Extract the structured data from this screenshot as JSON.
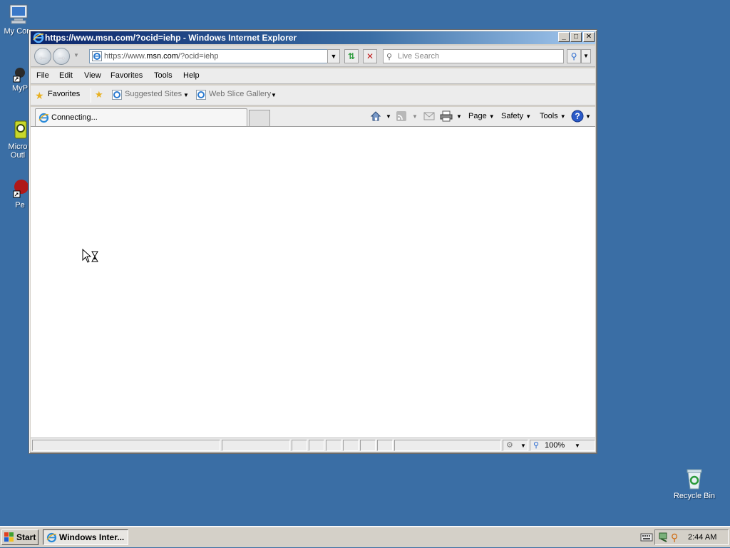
{
  "desktop": {
    "icons": [
      {
        "label": "My Com",
        "icon": "computer-icon"
      },
      {
        "label": "MyP",
        "icon": "mypc-shortcut-icon"
      },
      {
        "label": "Micro Outl",
        "icon": "outlook-icon"
      },
      {
        "label": "Pe",
        "icon": "shortcut-icon"
      },
      {
        "label": "Recycle Bin",
        "icon": "recycle-bin-icon"
      }
    ]
  },
  "window": {
    "title": "https://www.msn.com/?ocid=iehp - Windows Internet Explorer",
    "controls": {
      "minimize": "_",
      "maximize": "□",
      "close": "✕"
    }
  },
  "address": {
    "prefix": "https://www.",
    "domain": "msn.com",
    "path": "/?ocid=iehp"
  },
  "search": {
    "placeholder": "Live Search"
  },
  "menu": {
    "items": [
      "File",
      "Edit",
      "View",
      "Favorites",
      "Tools",
      "Help"
    ]
  },
  "favorites_bar": {
    "favorites": "Favorites",
    "suggested": "Suggested Sites",
    "webslice": "Web Slice Gallery"
  },
  "tab": {
    "label": "Connecting..."
  },
  "command_bar": {
    "page": "Page",
    "safety": "Safety",
    "tools": "Tools"
  },
  "status": {
    "zoom": "100%"
  },
  "taskbar": {
    "start": "Start",
    "task": "Windows Inter...",
    "clock": "2:44 AM"
  },
  "colors": {
    "desktop": "#3a6ea5",
    "titlebar": "#0a246a"
  }
}
